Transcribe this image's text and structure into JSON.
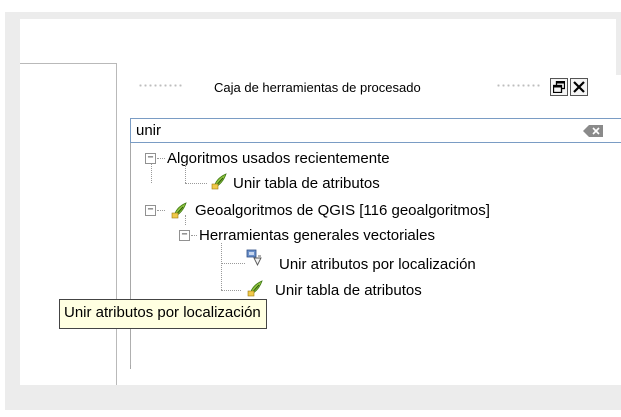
{
  "dock": {
    "title": "Caja de herramientas de procesado",
    "float_icon": "float-window-icon",
    "close_icon": "close-icon"
  },
  "search": {
    "value": "unir",
    "clear_icon": "clear-text-icon"
  },
  "tree": {
    "recent": {
      "label": "Algoritmos usados recientemente",
      "items": [
        {
          "label": "Unir tabla de atributos",
          "icon": "qgis-algorithm-icon"
        }
      ]
    },
    "qgis": {
      "label": "Geoalgoritmos de QGIS [116 geoalgoritmos]",
      "icon": "qgis-algorithm-icon",
      "group": {
        "label": "Herramientas generales vectoriales",
        "items": [
          {
            "label": "Unir atributos por localización",
            "icon": "vector-join-location-icon"
          },
          {
            "label": "Unir tabla de atributos",
            "icon": "qgis-algorithm-icon"
          }
        ]
      }
    }
  },
  "tooltip": {
    "text": "Unir atributos por localización"
  },
  "colors": {
    "tooltip_bg": "#ffffe1",
    "search_border": "#7a9cc4",
    "frame_bg": "#ececec"
  }
}
